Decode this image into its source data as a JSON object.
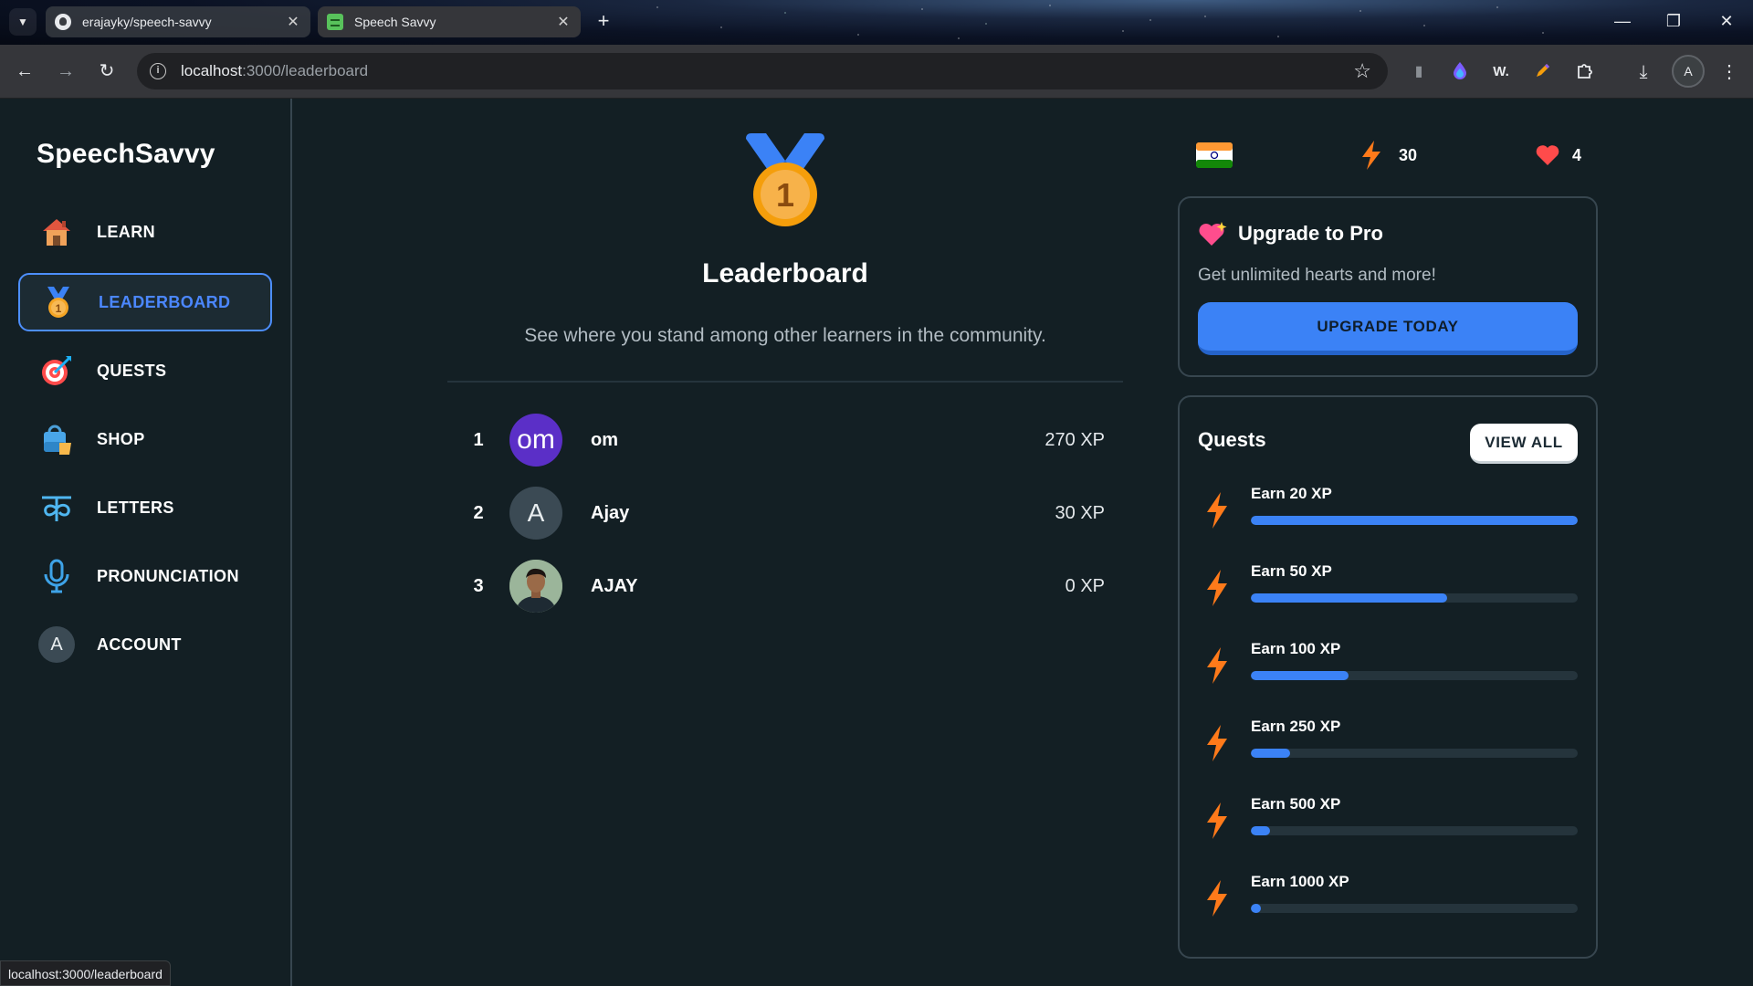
{
  "browser": {
    "tabs": [
      {
        "title": "erajayky/speech-savvy"
      },
      {
        "title": "Speech Savvy"
      }
    ],
    "url_host": "localhost",
    "url_rest": ":3000/leaderboard",
    "profile_initial": "A",
    "status_url": "localhost:3000/leaderboard"
  },
  "sidebar": {
    "brand": "SpeechSavvy",
    "items": [
      {
        "label": "LEARN",
        "icon": "house-icon"
      },
      {
        "label": "LEADERBOARD",
        "icon": "medal-icon",
        "active": true
      },
      {
        "label": "QUESTS",
        "icon": "target-icon"
      },
      {
        "label": "SHOP",
        "icon": "shopping-bag-icon"
      },
      {
        "label": "LETTERS",
        "icon": "devanagari-letter-icon"
      },
      {
        "label": "PRONUNCIATION",
        "icon": "microphone-icon"
      },
      {
        "label": "ACCOUNT",
        "icon": "account-avatar",
        "initial": "A"
      }
    ]
  },
  "leaderboard": {
    "medal_number": "1",
    "title": "Leaderboard",
    "subtitle": "See where you stand among other learners in the community.",
    "rows": [
      {
        "rank": "1",
        "avatar_text": "om",
        "name": "om",
        "xp": "270 XP"
      },
      {
        "rank": "2",
        "avatar_text": "A",
        "name": "Ajay",
        "xp": "30 XP"
      },
      {
        "rank": "3",
        "avatar_text": "",
        "name": "AJAY",
        "xp": "0 XP"
      }
    ]
  },
  "stats": {
    "language_flag": "india-flag-icon",
    "xp_points": "30",
    "hearts": "4"
  },
  "pro": {
    "title": "Upgrade to Pro",
    "subtitle": "Get unlimited hearts and more!",
    "button": "UPGRADE TODAY"
  },
  "quests": {
    "title": "Quests",
    "view_all": "VIEW ALL",
    "items": [
      {
        "label": "Earn 20 XP",
        "progress": 1.0
      },
      {
        "label": "Earn 50 XP",
        "progress": 0.6
      },
      {
        "label": "Earn 100 XP",
        "progress": 0.3
      },
      {
        "label": "Earn 250 XP",
        "progress": 0.12
      },
      {
        "label": "Earn 500 XP",
        "progress": 0.06
      },
      {
        "label": "Earn 1000 XP",
        "progress": 0.03
      }
    ]
  },
  "colors": {
    "accent": "#3b82f6",
    "background": "#131f24",
    "border": "#37464f",
    "om_avatar": "#5b2fc7",
    "a_avatar": "#3b4a54"
  }
}
